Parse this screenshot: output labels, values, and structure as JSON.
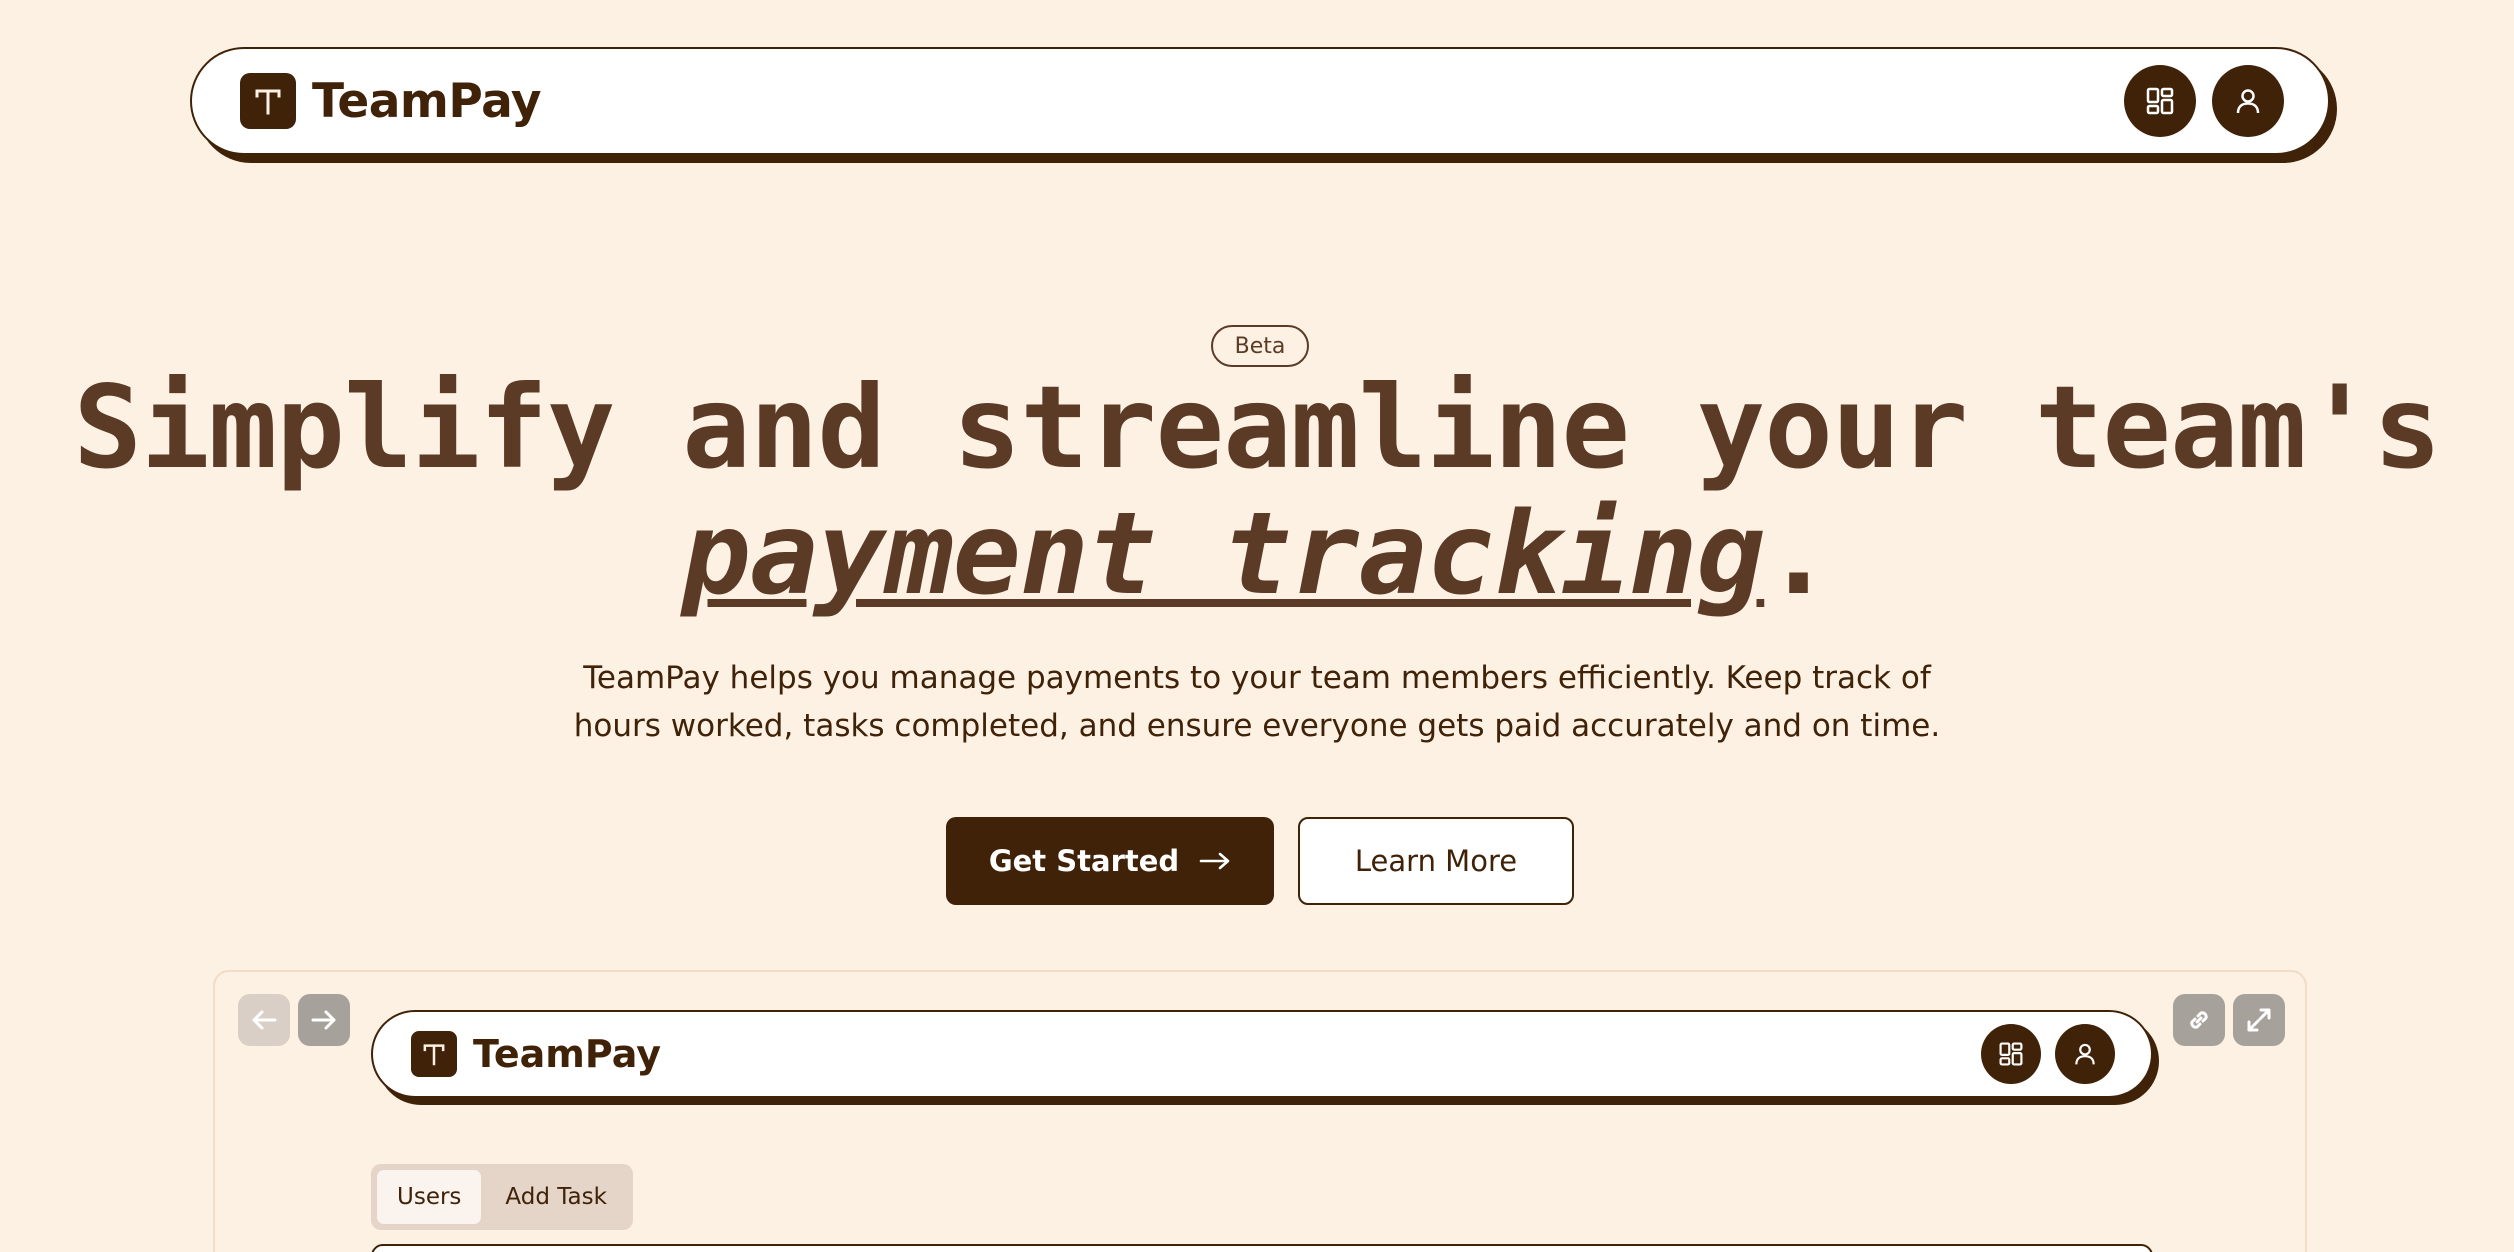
{
  "colors": {
    "background": "#fdf1e3",
    "brand_dark": "#3f2208",
    "heading_brown": "#5b3a26",
    "white": "#ffffff"
  },
  "nav": {
    "brand_name": "TeamPay",
    "logo_icon": "t-logo-icon",
    "actions": [
      {
        "icon": "dashboard-grid-icon"
      },
      {
        "icon": "user-icon"
      }
    ]
  },
  "hero": {
    "badge": "Beta",
    "headline_line1": "Simplify and streamline your team's",
    "headline_emphasis": "payment tracking",
    "headline_end": ".",
    "subtext": "TeamPay helps you manage payments to your team members efficiently. Keep track of hours worked, tasks completed, and ensure everyone gets paid accurately and on time.",
    "primary_button": "Get Started",
    "primary_button_icon": "arrow-right-icon",
    "secondary_button": "Learn More"
  },
  "preview": {
    "controls": [
      "arrow-left-icon",
      "arrow-right-icon",
      "link-icon",
      "expand-icon"
    ],
    "brand_name": "TeamPay",
    "tabs": [
      {
        "label": "Users",
        "active": true
      },
      {
        "label": "Add Task",
        "active": false
      }
    ]
  }
}
